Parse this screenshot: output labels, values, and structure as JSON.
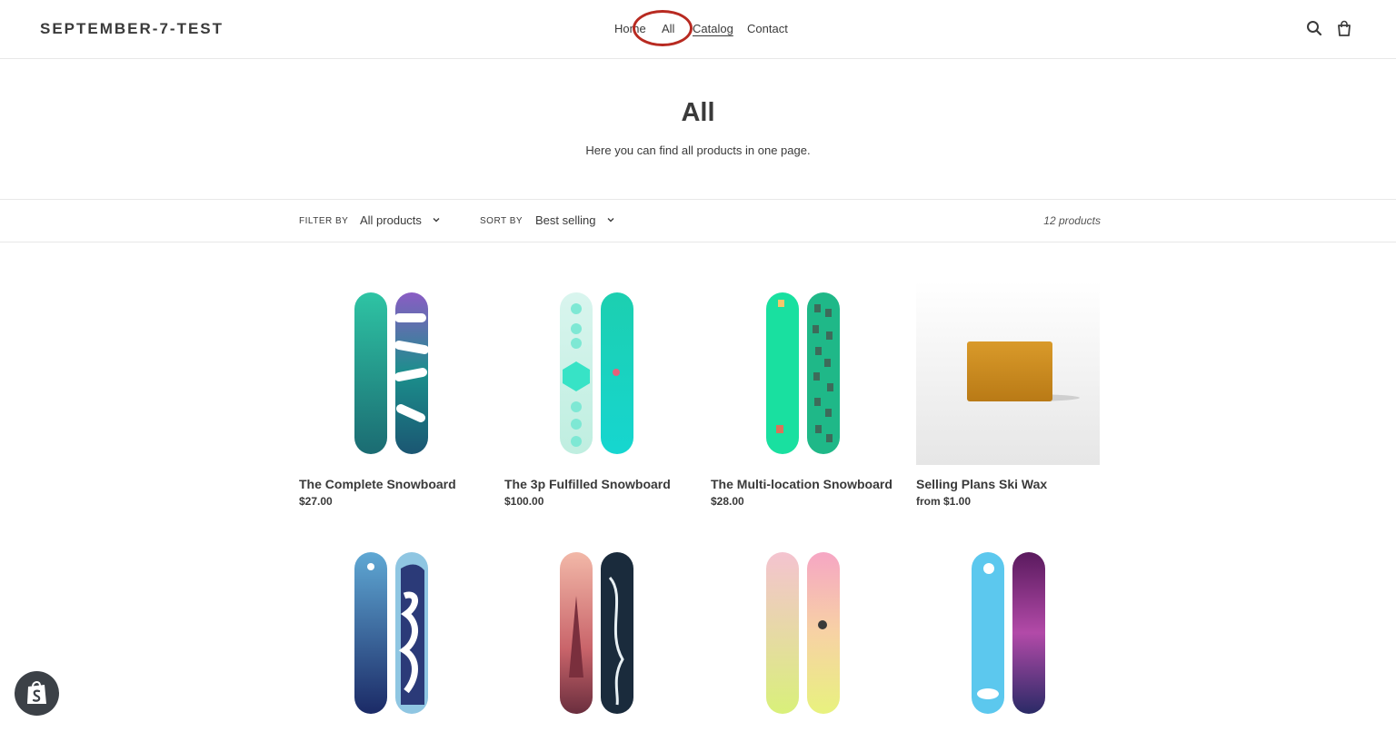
{
  "header": {
    "store_name": "SEPTEMBER-7-TEST",
    "nav": [
      "Home",
      "All",
      "Catalog",
      "Contact"
    ],
    "icons": [
      "search-icon",
      "cart-icon"
    ]
  },
  "collection": {
    "title": "All",
    "description": "Here you can find all products in one page."
  },
  "toolbar": {
    "filter_label": "FILTER BY",
    "filter_value": "All products",
    "sort_label": "SORT BY",
    "sort_value": "Best selling",
    "count": "12 products"
  },
  "products": [
    {
      "title": "The Complete Snowboard",
      "price": "$27.00"
    },
    {
      "title": "The 3p Fulfilled Snowboard",
      "price": "$100.00"
    },
    {
      "title": "The Multi-location Snowboard",
      "price": "$28.00"
    },
    {
      "title": "Selling Plans Ski Wax",
      "price": "from $1.00"
    },
    {
      "title": "",
      "price": ""
    },
    {
      "title": "",
      "price": ""
    },
    {
      "title": "",
      "price": ""
    },
    {
      "title": "",
      "price": ""
    }
  ],
  "colors": {
    "text": "#3a3a3a",
    "annotation_ring": "#b82a21",
    "shopify_badge": "#3c4147"
  }
}
